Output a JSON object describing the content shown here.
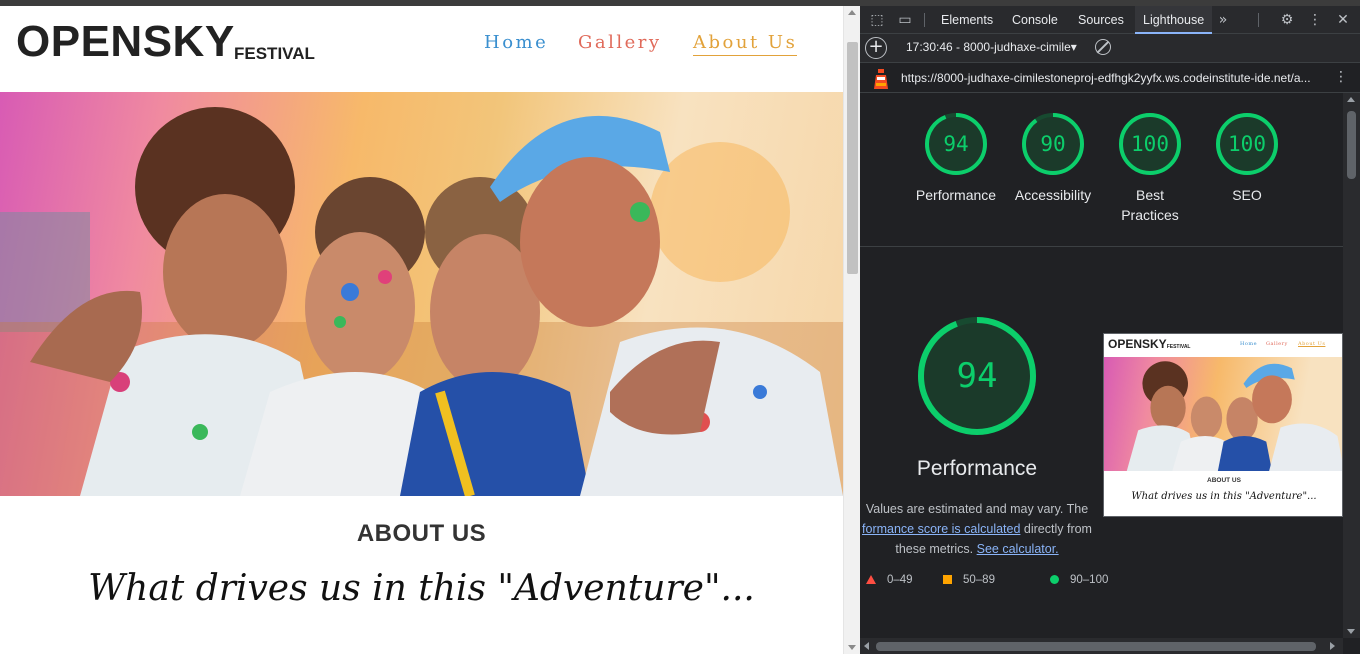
{
  "site": {
    "logo_main": "OPENSKY",
    "logo_sub": "FESTIVAL",
    "nav": {
      "home": "Home",
      "gallery": "Gallery",
      "about": "About Us"
    },
    "about_title": "ABOUT US",
    "tagline": "What drives us in this \"Adventure\"..."
  },
  "devtools": {
    "tabs": [
      "Elements",
      "Console",
      "Sources",
      "Lighthouse"
    ],
    "active_tab": "Lighthouse",
    "more_tabs_icon": "double-chevron-right-icon",
    "report_selector": "17:30:46 - 8000-judhaxe-cimile▾",
    "url": "https://8000-judhaxe-cimilestoneproj-edfhgk2yyfx.ws.codeinstitute-ide.net/a...",
    "scores": [
      {
        "value": 94,
        "label": "Performance"
      },
      {
        "value": 90,
        "label": "Accessibility"
      },
      {
        "value": 100,
        "label": "Best Practices"
      },
      {
        "value": 100,
        "label": "SEO"
      }
    ],
    "performance": {
      "value": 94,
      "title": "Performance",
      "note_start": "Values are estimated and may vary. The",
      "note_link": "formance score is calculated",
      "note_mid": "directly from these metrics.",
      "note_link2": "See calculator."
    },
    "legend": [
      {
        "range": "0–49",
        "shape": "triangle",
        "color": "#ff4e42"
      },
      {
        "range": "50–89",
        "shape": "square",
        "color": "#ffa400"
      },
      {
        "range": "90–100",
        "shape": "circle",
        "color": "#0cce6b"
      }
    ],
    "colors": {
      "pass": "#0cce6b",
      "link": "#8ab4f8",
      "active_tab": "#8ab4f8"
    }
  }
}
